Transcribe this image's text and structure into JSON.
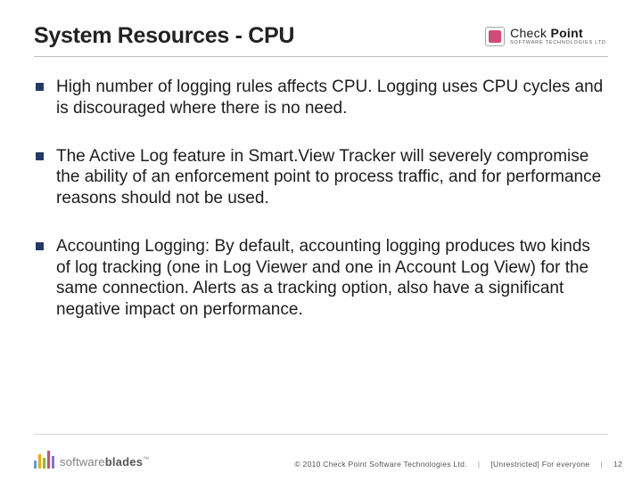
{
  "header": {
    "title": "System Resources - CPU",
    "logo": {
      "brand_prefix": "Check ",
      "brand_bold": "Point",
      "tagline": "SOFTWARE TECHNOLOGIES LTD."
    }
  },
  "bullets": [
    "High number of logging rules affects CPU. Logging uses CPU cycles and is discouraged where there is no need.",
    "The Active Log feature in Smart.View Tracker will severely compromise the ability of an enforcement point to process traffic, and for performance reasons should not be used.",
    "Accounting Logging: By default, accounting logging produces two kinds of log tracking (one in Log Viewer and one in Account Log View) for the same connection. Alerts as a tracking option, also have a significant negative impact on performance."
  ],
  "footer": {
    "product_prefix": "software",
    "product_bold": "blades",
    "tm": "™",
    "copyright": "© 2010 Check Point Software Technologies Ltd.",
    "classification": "[Unrestricted] For everyone",
    "page": "12"
  }
}
